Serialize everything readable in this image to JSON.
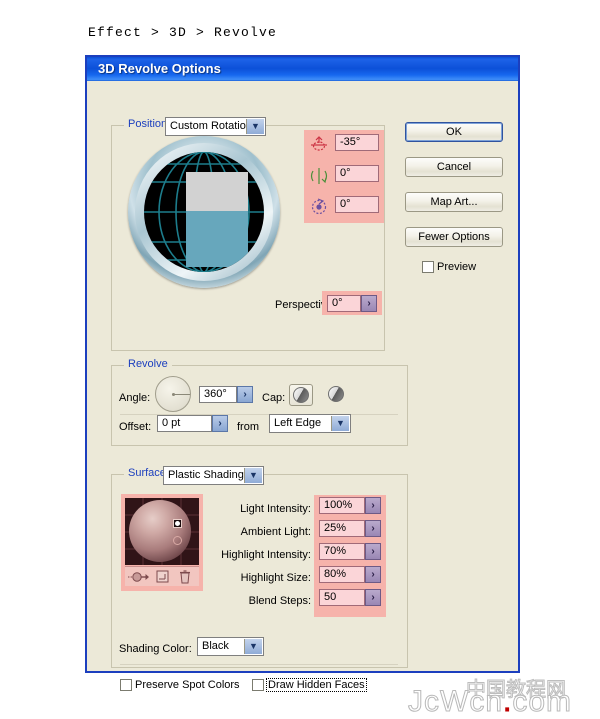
{
  "breadcrumb": "Effect  >  3D  >  Revolve",
  "dialog": {
    "title": "3D Revolve Options"
  },
  "buttons": {
    "ok": "OK",
    "cancel": "Cancel",
    "map_art": "Map Art...",
    "fewer_options": "Fewer Options"
  },
  "preview": {
    "label": "Preview",
    "checked": false
  },
  "position": {
    "group_label": "Position:",
    "selected": "Custom Rotation",
    "rotation": [
      {
        "axis": "x-axis",
        "icon": "rotate-x-icon",
        "value": "-35°",
        "color": "#cc3344"
      },
      {
        "axis": "y-axis",
        "icon": "rotate-y-icon",
        "value": "0°",
        "color": "#4a8f3a"
      },
      {
        "axis": "z-axis",
        "icon": "rotate-z-icon",
        "value": "0°",
        "color": "#6b4fa0"
      }
    ],
    "perspective_label": "Perspective:",
    "perspective_value": "0°"
  },
  "revolve": {
    "group_label": "Revolve",
    "angle_label": "Angle:",
    "angle_value": "360°",
    "cap_label": "Cap:",
    "cap_selected_index": 0,
    "offset_label": "Offset:",
    "offset_value": "0 pt",
    "from_label": "from",
    "from_value": "Left Edge"
  },
  "surface": {
    "group_label": "Surface:",
    "shading": "Plastic Shading",
    "rows": [
      {
        "label": "Light Intensity:",
        "value": "100%"
      },
      {
        "label": "Ambient Light:",
        "value": "25%"
      },
      {
        "label": "Highlight Intensity:",
        "value": "70%"
      },
      {
        "label": "Highlight Size:",
        "value": "80%"
      },
      {
        "label": "Blend Steps:",
        "value": "50"
      }
    ],
    "shading_color_label": "Shading Color:",
    "shading_color_value": "Black",
    "preserve_spot_colors": "Preserve Spot Colors",
    "draw_hidden_faces": "Draw Hidden Faces",
    "light_toolbar": [
      "new-light-icon",
      "duplicate-light-icon",
      "delete-light-icon"
    ]
  },
  "watermark": {
    "domain_a": "JcWcn",
    "domain_dot": ".",
    "domain_b": "com",
    "chinese": "中国教程网"
  },
  "colors": {
    "titlebar_blue": "#1056d8",
    "dialog_face": "#ece9d8",
    "highlight_pink": "#f6b3ab",
    "field_pink": "#fbd5d8",
    "group_blue": "#1c3fbe",
    "art_teal": "#67a7bc",
    "art_gray": "#d2d2d2"
  }
}
